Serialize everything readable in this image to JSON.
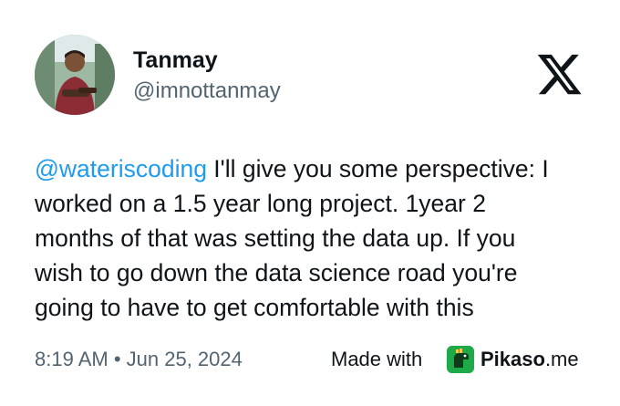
{
  "user": {
    "display_name": "Tanmay",
    "handle": "@imnottanmay"
  },
  "tweet": {
    "mention": "@wateriscoding",
    "lines": [
      " I'll give you some perspective: I",
      "worked on a 1.5 year long project. 1year 2",
      "months of that was setting the data up. If you",
      "wish to go down the data science road you're",
      "going to have to get comfortable with this"
    ],
    "timestamp": "8:19 AM • Jun 25, 2024"
  },
  "footer": {
    "made_with": "Made with",
    "brand_bold": "Pikaso",
    "brand_suffix": ".me"
  },
  "colors": {
    "text": "#0f1419",
    "secondary": "#536471",
    "mention": "#1d9bf0",
    "pikaso_green": "#1faa4a"
  },
  "icons": {
    "platform": "x-logo-icon",
    "brand": "pikaso-dinosaur-icon"
  }
}
